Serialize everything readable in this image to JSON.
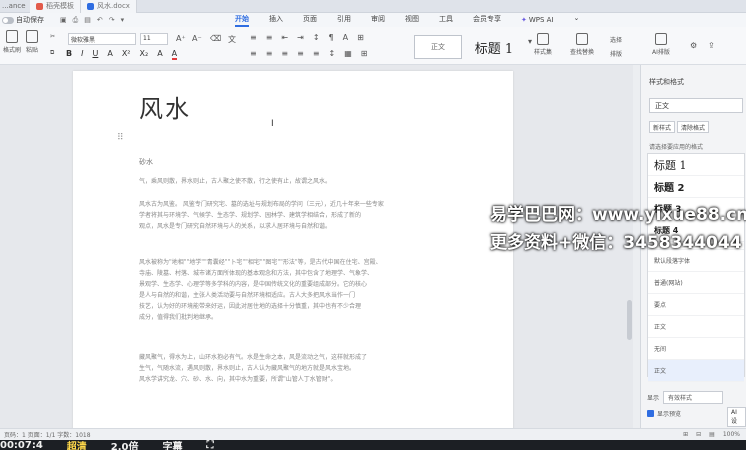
{
  "titlebar": {
    "app_label": "...ance",
    "tabs": [
      "稻壳模板",
      "风水.docx"
    ]
  },
  "menubar": {
    "autosave_label": "自动保存",
    "menus": [
      "开始",
      "插入",
      "页面",
      "引用",
      "审阅",
      "视图",
      "工具",
      "会员专享"
    ],
    "active_menu": "开始",
    "wps_ai": "WPS AI"
  },
  "ribbon": {
    "paste_label": "格式刷",
    "paste2_label": "粘贴",
    "font_name": "微软雅黑",
    "font_size": "11",
    "format_buttons": [
      "B",
      "I",
      "U",
      "A",
      "X²",
      "X₂",
      "A",
      "A"
    ],
    "para_buttons_top": [
      "≡",
      "≡",
      "⇤",
      "⇥",
      "↕",
      "¶",
      "A",
      "⊞"
    ],
    "para_buttons_bottom": [
      "≡",
      "≡",
      "≡",
      "≡",
      "≡",
      "↕",
      "▦",
      "⊞"
    ],
    "style_normal": "正文",
    "style_h1": "标题 1",
    "styles_btn": "样式集",
    "find_btn": "查找替换",
    "select_btn": "选择",
    "ai_btn": "AI排版",
    "layout_btn": "排版"
  },
  "document": {
    "title": "风水",
    "cursor": "I",
    "subtitle": "砂水",
    "paragraphs": [
      "气，乘风则散，界水则止，古人聚之使不散，行之使有止，故谓之风水。",
      "风水古为风鉴。 风鉴专门研究宅、墓的选址与规划布局的学问（三元），近几十年来一些专家\n学者将其与环境学、气候学、生态学、规划学、园林学、建筑学相结合，形成了新的\n观点，风水是专门研究自然环境与人的关系，以求人居环境与自然和谐。",
      "风水被称为\"地相\"\"地学\"\"青囊经\"\"卜宅\"\"相宅\"\"图宅\"\"形法\"等，是古代中国在住宅、宫殿、\n寺庙、陵墓、村落、城市诸方面所体现的基本观念和方法，其中包含了地理学、气象学、\n景观学、生态学、心理学等多学科的内容，是中国传统文化的重要组成部分。它的核心\n是人与自然的和谐，主张人类活动要与自然环境相适应。古人大多把风水当作一门\n技艺，认为好的环境能带来好运，因此对居住地的选择十分慎重，其中也有不少合理\n成分，值得我们批判地继承。",
      "藏风聚气，得水为上，山环水抱必有气。水是生命之本，风是流动之气，这样就形成了\n生气，气随水流，遇风则散，界水则止，古人认为藏风聚气的地方就是风水宝地。\n风水学讲究龙、穴、砂、水、向，其中水为重要，所谓\"山管人丁水管财\"。"
    ]
  },
  "panel": {
    "head": "样式和格式",
    "current_style": "正文",
    "btn_new": "新样式",
    "btn_clear": "清除格式",
    "label_pick": "请选择要应用的格式",
    "styles": [
      "标题 1",
      "标题 2",
      "标题 3",
      "标题 4",
      "",
      "默认段落字体",
      "普通(网站)",
      "要点",
      "正文",
      "无间",
      "正文"
    ],
    "show_label": "显示",
    "show_value": "有效样式",
    "preview_label": "显示预览",
    "ai_label": "AI 设"
  },
  "status": {
    "left": "页码：1  页面：1/1  字数：1018",
    "right": [
      "⊞",
      "⊟",
      "▤",
      "100%"
    ]
  },
  "watermark": {
    "line1": "易学巴巴网：www.yixue88.cn",
    "line2": "更多资料+微信：3458344044"
  },
  "videobar": {
    "items": [
      "00:07:4",
      "超清",
      "2.0倍",
      "字幕",
      "⛶"
    ]
  }
}
